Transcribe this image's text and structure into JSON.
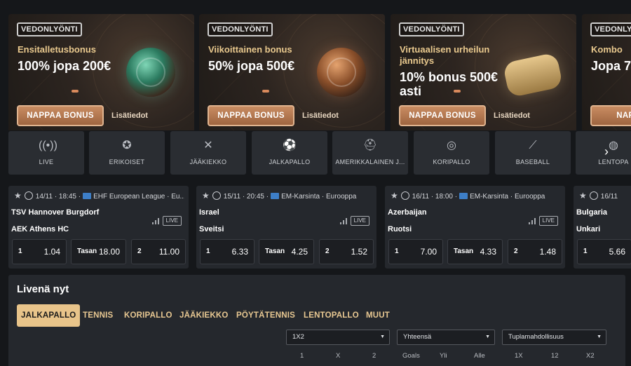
{
  "promos": [
    {
      "tag": "VEDONLYÖNTI",
      "title": "Ensitalletusbonus",
      "amount": "100% jopa 200€",
      "cta": "NAPPAA BONUS",
      "more": "Lisätiedot",
      "art": "soccer-ball-icon"
    },
    {
      "tag": "VEDONLYÖNTI",
      "title": "Viikoittainen bonus",
      "amount": "50% jopa 500€",
      "cta": "NAPPAA BONUS",
      "more": "Lisätiedot",
      "art": "basketball-icon"
    },
    {
      "tag": "VEDONLYÖNTI",
      "title": "Virtuaalisen urheilun jännitys",
      "amount": "10% bonus 500€ asti",
      "cta": "NAPPAA BONUS",
      "more": "Lisätiedot",
      "art": "gamepad-icon"
    },
    {
      "tag": "VEDONLYÖNTI",
      "title": "Kombo",
      "amount": "Jopa 7",
      "cta": "NAPPAA",
      "more": "",
      "art": ""
    }
  ],
  "sports": [
    {
      "label": "LIVE",
      "icon": "live-signal-icon"
    },
    {
      "label": "ERIKOISET",
      "icon": "medal-icon"
    },
    {
      "label": "JÄÄKIEKKO",
      "icon": "hockey-sticks-icon"
    },
    {
      "label": "JALKAPALLO",
      "icon": "soccer-ball-icon"
    },
    {
      "label": "AMERIKKALAINEN J...",
      "icon": "football-helmet-icon"
    },
    {
      "label": "KORIPALLO",
      "icon": "basketball-icon"
    },
    {
      "label": "BASEBALL",
      "icon": "baseball-bat-icon"
    },
    {
      "label": "LENTOPA",
      "icon": "volleyball-icon"
    }
  ],
  "matches": [
    {
      "datetime": "14/11 · 18:45",
      "league": "EHF European League",
      "region": "Eu...",
      "team1": "TSV Hannover Burgdorf",
      "team2": "AEK Athens HC",
      "live": "LIVE",
      "odds": [
        {
          "label": "1",
          "value": "1.04"
        },
        {
          "label": "Tasan",
          "value": "18.00"
        },
        {
          "label": "2",
          "value": "11.00"
        }
      ]
    },
    {
      "datetime": "15/11 · 20:45",
      "league": "EM-Karsinta",
      "region": "Eurooppa",
      "team1": "Israel",
      "team2": "Sveitsi",
      "live": "LIVE",
      "odds": [
        {
          "label": "1",
          "value": "6.33"
        },
        {
          "label": "Tasan",
          "value": "4.25"
        },
        {
          "label": "2",
          "value": "1.52"
        }
      ]
    },
    {
      "datetime": "16/11 · 18:00",
      "league": "EM-Karsinta",
      "region": "Eurooppa",
      "team1": "Azerbaijan",
      "team2": "Ruotsi",
      "live": "LIVE",
      "odds": [
        {
          "label": "1",
          "value": "7.00"
        },
        {
          "label": "Tasan",
          "value": "4.33"
        },
        {
          "label": "2",
          "value": "1.48"
        }
      ]
    },
    {
      "datetime": "16/11",
      "league": "",
      "region": "",
      "team1": "Bulgaria",
      "team2": "Unkari",
      "live": "",
      "odds": [
        {
          "label": "1",
          "value": "5.66"
        }
      ]
    }
  ],
  "live_now": {
    "title": "Livenä nyt",
    "tabs": [
      "JALKAPALLO",
      "TENNIS",
      "KORIPALLO",
      "JÄÄKIEKKO",
      "PÖYTÄTENNIS",
      "LENTOPALLO",
      "MUUT"
    ],
    "selects": [
      {
        "value": "1X2",
        "columns": [
          "1",
          "X",
          "2"
        ]
      },
      {
        "value": "Yhteensä",
        "columns": [
          "Goals",
          "Yli",
          "Alle"
        ]
      },
      {
        "value": "Tuplamahdollisuus",
        "columns": [
          "1X",
          "12",
          "X2"
        ]
      }
    ]
  },
  "colors": {
    "accent": "#e8c48a",
    "cta": "#b07650",
    "bg": "#15171a",
    "card": "#25282d"
  }
}
